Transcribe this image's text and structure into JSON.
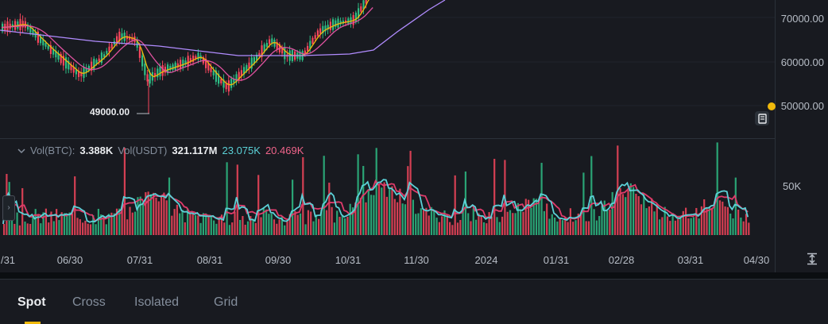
{
  "price_axis": {
    "ticks": [
      "70000.00",
      "60000.00",
      "50000.00"
    ]
  },
  "chart_low_label": "49000.00",
  "volume": {
    "label_btc": "Vol(BTC):",
    "value_btc": "3.388K",
    "label_usdt": "Vol(USDT)",
    "value_usdt": "321.117M",
    "ma1": "23.075K",
    "ma2": "20.469K",
    "axis_tick": "50K"
  },
  "time_axis": [
    "/31",
    "06/30",
    "07/31",
    "08/31",
    "09/30",
    "10/31",
    "11/30",
    "2024",
    "01/31",
    "02/28",
    "03/31",
    "04/30"
  ],
  "tabs": [
    {
      "label": "Spot",
      "active": true
    },
    {
      "label": "Cross",
      "active": false
    },
    {
      "label": "Isolated",
      "active": false
    },
    {
      "label": "Grid",
      "active": false
    }
  ],
  "colors": {
    "up": "#2ebd85",
    "down": "#f6465d",
    "ma7": "#f0b90b",
    "ma25": "#e052a0",
    "ma99": "#b18cff",
    "vol_ma1": "#5bd1d7",
    "vol_ma2": "#e03b6b",
    "accent": "#f0b90b"
  },
  "icons": {
    "scroll_to_latest": "expand-vertical-icon",
    "alert_marker": "note-icon",
    "collapse_handle": "chevron-right-icon"
  }
}
